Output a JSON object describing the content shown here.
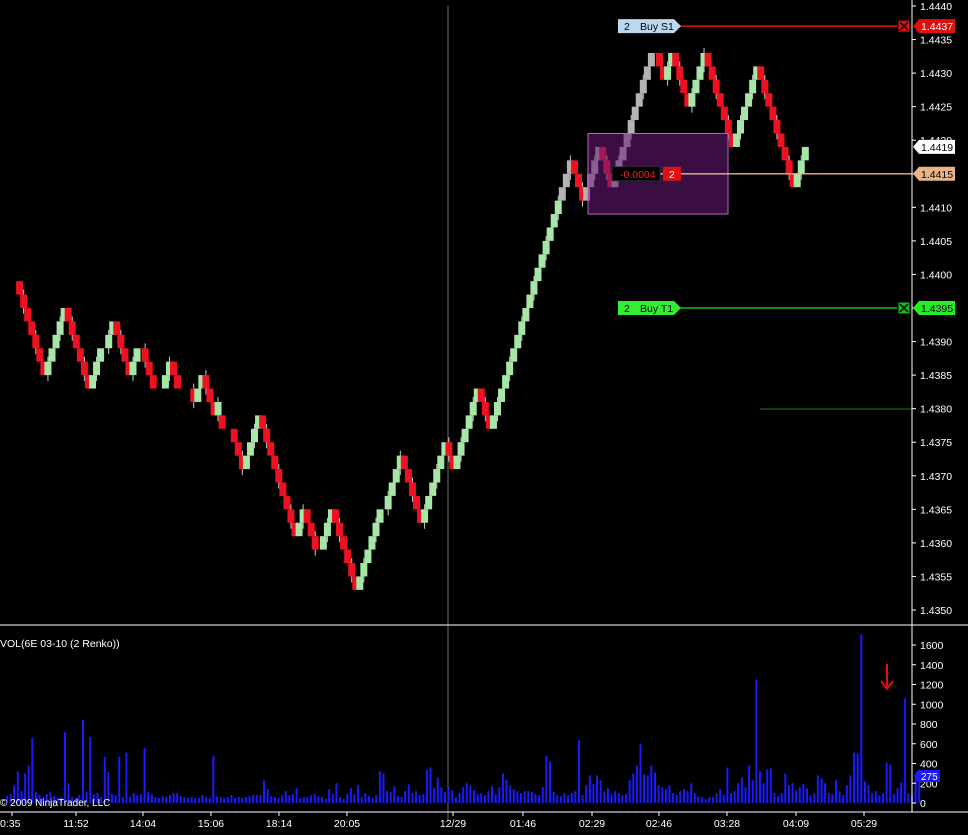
{
  "colors": {
    "background": "#000000",
    "up_brick": "#a8e6a8",
    "down_brick": "#ee1122",
    "neutral_brick": "#b4b4b4",
    "wick": "#c8c8c8",
    "volume_bar": "#1a1aff",
    "stop_line": "#e01010",
    "target_line": "#10c010",
    "entry_line": "#e8b58a",
    "position_box": "#6a1a7a",
    "axis_text": "#ffffff"
  },
  "chart_data": [
    {
      "type": "renko",
      "title": "",
      "xlabel": "",
      "ylabel": "",
      "ylim": [
        1.43475,
        1.4441
      ],
      "y_ticks": [
        "1.4440",
        "1.4435",
        "1.4430",
        "1.4425",
        "1.4420",
        "1.4415",
        "1.4410",
        "1.4405",
        "1.4400",
        "1.4395",
        "1.4390",
        "1.4385",
        "1.4380",
        "1.4375",
        "1.4370",
        "1.4365",
        "1.4360",
        "1.4355",
        "1.4350"
      ],
      "x_ticks": [
        "0:35",
        "11:52",
        "14:04",
        "15:06",
        "18:14",
        "20:05",
        "12/29",
        "01:46",
        "02:29",
        "02:46",
        "03:28",
        "04:09",
        "05:29"
      ],
      "brick_size": 0.0002,
      "brick_closes": [
        1.4399,
        1.4399,
        1.4397,
        1.4395,
        1.4393,
        1.4391,
        1.4389,
        1.4387,
        1.4385,
        1.4387,
        1.4389,
        1.4391,
        1.4393,
        1.4395,
        1.4393,
        1.4391,
        1.4389,
        1.4387,
        1.4385,
        1.4383,
        1.4385,
        1.4387,
        1.4389,
        1.4389,
        1.4391,
        1.4393,
        1.4391,
        1.4389,
        1.4387,
        1.4385,
        1.4387,
        1.4389,
        1.4389,
        1.4387,
        1.4385,
        1.4383,
        1.4383,
        1.4383,
        1.4385,
        1.4387,
        1.4385,
        1.4383,
        1.4383,
        1.4383,
        1.4383,
        1.4381,
        1.4383,
        1.4385,
        1.4383,
        1.4381,
        1.4379,
        1.4381,
        1.4377,
        1.4377,
        1.4377,
        1.4375,
        1.4373,
        1.4371,
        1.4373,
        1.4375,
        1.4377,
        1.4379,
        1.4377,
        1.4375,
        1.4373,
        1.4371,
        1.4369,
        1.4367,
        1.4365,
        1.4363,
        1.4361,
        1.4363,
        1.4365,
        1.4363,
        1.4361,
        1.4359,
        1.4359,
        1.4361,
        1.4363,
        1.4365,
        1.4363,
        1.4361,
        1.4359,
        1.4357,
        1.4355,
        1.4353,
        1.4355,
        1.4357,
        1.4359,
        1.4361,
        1.4363,
        1.4365,
        1.4365,
        1.4367,
        1.4369,
        1.4371,
        1.4373,
        1.4371,
        1.4369,
        1.4367,
        1.4365,
        1.4363,
        1.4365,
        1.4367,
        1.4369,
        1.4371,
        1.4373,
        1.4375,
        1.4373,
        1.4371,
        1.4373,
        1.4375,
        1.4377,
        1.4379,
        1.4381,
        1.4383,
        1.4381,
        1.4379,
        1.4377,
        1.4379,
        1.4381,
        1.4383,
        1.4385,
        1.4387,
        1.4389,
        1.4391,
        1.4393,
        1.4395,
        1.4397,
        1.4399,
        1.4401,
        1.4403,
        1.4405,
        1.4407,
        1.4409,
        1.4411,
        1.4413,
        1.4415,
        1.4417,
        1.4415,
        1.4413,
        1.4411,
        1.4413,
        1.4415,
        1.4417,
        1.4419,
        1.4417,
        1.4415,
        1.4413,
        1.4415,
        1.4417,
        1.4419,
        1.4421,
        1.4423,
        1.4425,
        1.4427,
        1.4429,
        1.4431,
        1.4433,
        1.4433,
        1.4431,
        1.4429,
        1.4431,
        1.4433,
        1.4431,
        1.4429,
        1.4427,
        1.4425,
        1.4427,
        1.4429,
        1.4431,
        1.4433,
        1.4431,
        1.4429,
        1.4427,
        1.4425,
        1.4423,
        1.4421,
        1.4419,
        1.4421,
        1.4423,
        1.4425,
        1.4427,
        1.4429,
        1.4431,
        1.4429,
        1.4427,
        1.4425,
        1.4423,
        1.4421,
        1.4419,
        1.4417,
        1.4415,
        1.4413,
        1.4415,
        1.4417,
        1.4419
      ],
      "neutral_brick_range": [
        136,
        160
      ],
      "current_price_label": "1.4419",
      "entry_price_label": "1.4415",
      "order_lines": [
        {
          "qty": "2",
          "name": "Buy S1",
          "price": "1.4437",
          "kind": "stop",
          "y_value": 1.4437
        },
        {
          "qty": "2",
          "name": "Buy T1",
          "price": "1.4395",
          "kind": "target",
          "y_value": 1.4395
        }
      ],
      "position_box": {
        "pnl": "-0.0004",
        "qty": "2",
        "y_top": 1.4421,
        "y_bottom": 1.4409
      },
      "marker_line_value": 1.43802,
      "divider_label": "12/29"
    },
    {
      "type": "bar",
      "title": "VOL(6E 03-10 (2 Renko))",
      "ylim": [
        0,
        1720
      ],
      "y_ticks": [
        "0",
        "200",
        "400",
        "600",
        "800",
        "1000",
        "1200",
        "1400",
        "1600"
      ],
      "last_value_label": "275",
      "highlight_bar_index": 196,
      "values": [
        70,
        90,
        180,
        320,
        120,
        300,
        380,
        660,
        110,
        80,
        60,
        90,
        110,
        70,
        50,
        60,
        720,
        200,
        60,
        50,
        80,
        840,
        110,
        670,
        90,
        100,
        60,
        470,
        310,
        90,
        80,
        470,
        60,
        510,
        60,
        100,
        80,
        90,
        560,
        110,
        90,
        60,
        50,
        70,
        60,
        80,
        100,
        100,
        70,
        60,
        50,
        60,
        50,
        50,
        80,
        60,
        50,
        480,
        70,
        60,
        50,
        60,
        80,
        50,
        60,
        50,
        60,
        70,
        80,
        80,
        80,
        230,
        140,
        70,
        60,
        50,
        80,
        120,
        80,
        90,
        150,
        50,
        60,
        60,
        80,
        90,
        70,
        60,
        40,
        140,
        90,
        200,
        60,
        40,
        90,
        150,
        90,
        180,
        60,
        100,
        70,
        50,
        80,
        320,
        300,
        120,
        110,
        170,
        70,
        60,
        120,
        190,
        100,
        120,
        80,
        90,
        340,
        360,
        150,
        260,
        160,
        110,
        160,
        130,
        60,
        100,
        160,
        200,
        180,
        130,
        90,
        100,
        80,
        120,
        170,
        90,
        160,
        300,
        230,
        180,
        140,
        120,
        100,
        120,
        120,
        110,
        90,
        80,
        160,
        480,
        420,
        110,
        80,
        70,
        100,
        80,
        100,
        120,
        640,
        80,
        180,
        280,
        190,
        280,
        230,
        120,
        150,
        90,
        120,
        100,
        80,
        90,
        230,
        300,
        380,
        600,
        290,
        280,
        380,
        310,
        180,
        160,
        140,
        180,
        100,
        80,
        120,
        140,
        120,
        200,
        100,
        70,
        60,
        40,
        60,
        60,
        100,
        140,
        80,
        360,
        100,
        120,
        200,
        260,
        160,
        380,
        230,
        1250,
        320,
        200,
        340,
        350,
        100,
        70,
        100,
        300,
        180,
        200,
        130,
        160,
        190,
        150,
        80,
        100,
        280,
        250,
        200,
        100,
        90,
        230,
        120,
        80,
        180,
        280,
        510,
        500,
        1710,
        220,
        180,
        100,
        120,
        80,
        100,
        410,
        390,
        90,
        150,
        210,
        1060,
        100,
        80,
        250,
        270
      ]
    }
  ],
  "footer": {
    "copyright": "© 2009 NinjaTrader, LLC"
  }
}
